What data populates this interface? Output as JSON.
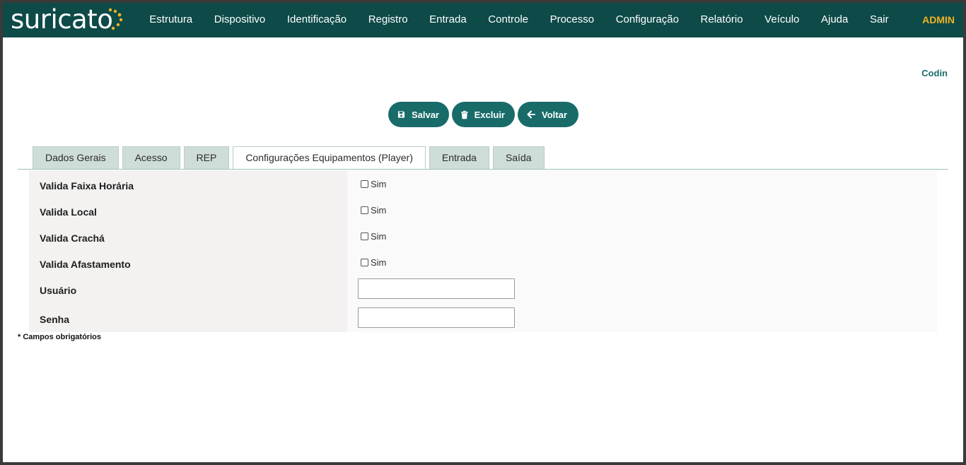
{
  "brand": {
    "logo_text": "suricato",
    "colors": {
      "navbar": "#0d4a48",
      "accent": "#f0b323",
      "button": "#186b69"
    }
  },
  "nav": {
    "items": [
      "Estrutura",
      "Dispositivo",
      "Identificação",
      "Registro",
      "Entrada",
      "Controle",
      "Processo",
      "Configuração",
      "Relatório",
      "Veículo",
      "Ajuda",
      "Sair"
    ],
    "user": "ADMIN"
  },
  "header": {
    "right_label": "Codin"
  },
  "actions": {
    "save": "Salvar",
    "delete": "Excluir",
    "back": "Voltar"
  },
  "tabs": [
    "Dados Gerais",
    "Acesso",
    "REP",
    "Configurações Equipamentos (Player)",
    "Entrada",
    "Saída"
  ],
  "active_tab": "Configurações Equipamentos (Player)",
  "form": {
    "valida_faixa": {
      "label": "Valida Faixa Horária",
      "option": "Sim",
      "checked": false
    },
    "valida_local": {
      "label": "Valida Local",
      "option": "Sim",
      "checked": false
    },
    "valida_cracha": {
      "label": "Valida Crachá",
      "option": "Sim",
      "checked": false
    },
    "valida_afastamento": {
      "label": "Valida Afastamento",
      "option": "Sim",
      "checked": false
    },
    "usuario": {
      "label": "Usuário",
      "value": ""
    },
    "senha": {
      "label": "Senha",
      "value": ""
    }
  },
  "footer_note": "* Campos obrigatórios"
}
